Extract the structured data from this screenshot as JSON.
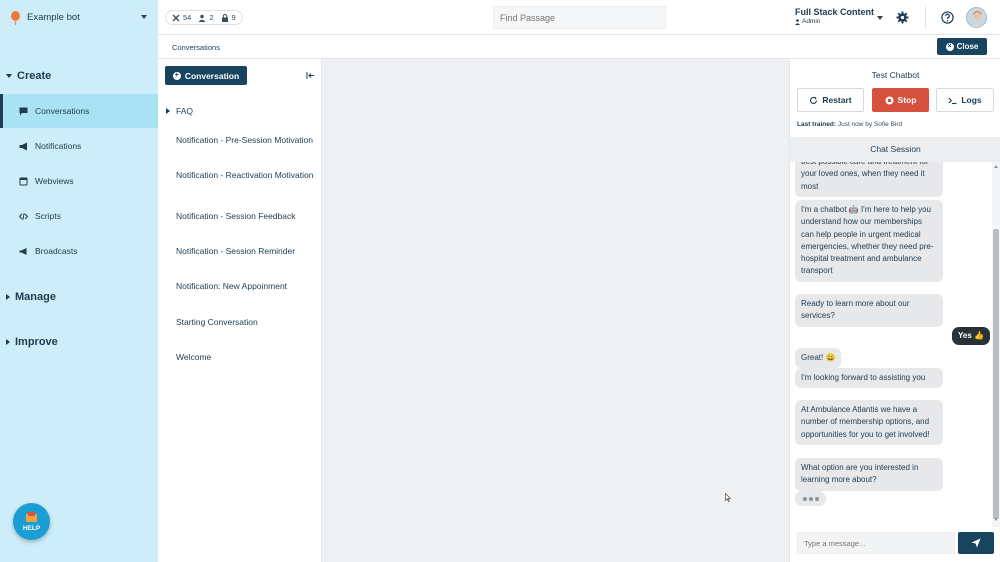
{
  "topbar": {
    "bot_name": "Example bot",
    "stats": [
      {
        "icon": "tools-icon",
        "value": "54"
      },
      {
        "icon": "users-icon",
        "value": "2"
      },
      {
        "icon": "lock-icon",
        "value": "9"
      }
    ],
    "find_placeholder": "Find Passage",
    "org_name": "Full Stack Content",
    "role": "Admin"
  },
  "sidebar": {
    "create": "Create",
    "items": [
      {
        "label": "Conversations",
        "icon": "chat-icon"
      },
      {
        "label": "Notifications",
        "icon": "megaphone-icon"
      },
      {
        "label": "Webviews",
        "icon": "window-icon"
      },
      {
        "label": "Scripts",
        "icon": "code-icon"
      },
      {
        "label": "Broadcasts",
        "icon": "broadcast-icon"
      }
    ],
    "manage": "Manage",
    "improve": "Improve",
    "help": "HELP"
  },
  "breadcrumb": "Conversations",
  "close_label": "Close",
  "passages": {
    "new_button": "Conversation",
    "folder": "FAQ",
    "items": [
      "Notification - Pre-Session Motivation",
      "Notification - Reactivation Motivation",
      "Notification - Session Feedback",
      "Notification - Session Reminder",
      "Notification: New Appoinment",
      "Starting Conversation",
      "Welcome"
    ]
  },
  "chat": {
    "title": "Test Chatbot",
    "restart": "Restart",
    "stop": "Stop",
    "logs": "Logs",
    "last_trained_label": "Last trained:",
    "last_trained_value": "Just now by Sofie Bird",
    "session": "Chat Session",
    "messages": [
      {
        "from": "bot",
        "text": "best possible care and treatment for your loved ones, when they need it most"
      },
      {
        "from": "bot",
        "text": "I'm a chatbot 🤖 I'm here to help you understand how our memberships can help people in urgent medical emergencies, whether they need pre-hospital treatment and ambulance transport"
      },
      {
        "from": "bot",
        "text": "Ready to learn more about our services?"
      },
      {
        "from": "user",
        "text": "Yes 👍"
      },
      {
        "from": "bot",
        "text": "Great! 😀"
      },
      {
        "from": "bot",
        "text": "I'm looking forward to assisting you"
      },
      {
        "from": "bot",
        "text": "At Ambulance Atlantis we have a number of membership options, and opportunities for you to get involved!"
      },
      {
        "from": "bot",
        "text": "What option are you interested in learning more about?"
      }
    ],
    "input_placeholder": "Type a message..."
  }
}
